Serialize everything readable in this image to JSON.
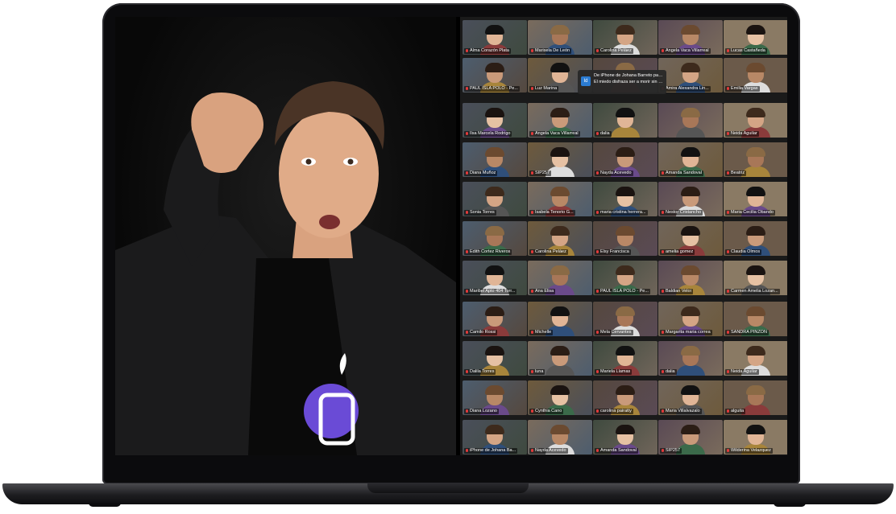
{
  "app": "Zoom gallery view on laptop",
  "colors": {
    "active_speaker_border": "#c8e64a",
    "muted_mic": "#e23b3b"
  },
  "chat_notification": {
    "avatar": "Id",
    "sender": "De iPhone de Johana Barreto para...",
    "message": "El miedo disfraza ser a morir sin te..."
  },
  "panels": [
    {
      "tiles": [
        "Alma Corazón Plata",
        "Marisela De León",
        "Carolina Peláez",
        "Angela Vaca Villarreal",
        "Lucas Castañeda",
        "PAUL ISLA POLO - Pe...",
        "Luz Marina",
        "",
        "Amira Alexandra Lin...",
        "Emilia Vargas"
      ]
    },
    {
      "tiles": [
        "Ilsa Marcela Rodrigo",
        "Angela Vaca Villarreal",
        "dalia",
        "",
        "Neida Aguilar",
        "Diana Muñoz",
        "SIP257",
        "Nayda Acevedo",
        "Amanda Sandoval",
        "Beatriz",
        "Sonia Torres",
        "Isabela Tenorio G...",
        "maria cristina herrera...",
        "Nestor Cristancho",
        "Maria Cecilia Obando",
        "Edith Cortez Riveros",
        "Carolina Peláez",
        "Elsy Francisca",
        "amelia gomez",
        "Claudia Olmos",
        "Maribel Apto 404 Torr...",
        "Ana Elisa",
        "PAUL ISLA POLO - Pe...",
        "Baldian Veloi",
        "Carmen Amelia Lozan..."
      ]
    },
    {
      "tiles": [
        "Camilo Rossi",
        "Michelle",
        "Mela Cervantes",
        "Margarita maria correa",
        "SANDRA PINZÓN",
        "Dalila Torres",
        "luna",
        "Mariela Llamas",
        "dalia",
        "Neida Aguilar",
        "Diana Lozano",
        "Cynthia Cano",
        "carolina pairatty",
        "Maria Villalvazalo",
        "alguita",
        "iPhone de Johana Ba...",
        "Nayda Acevedo",
        "Amanda Sandoval",
        "SIP257",
        "Wilderina Velazquez"
      ]
    }
  ]
}
